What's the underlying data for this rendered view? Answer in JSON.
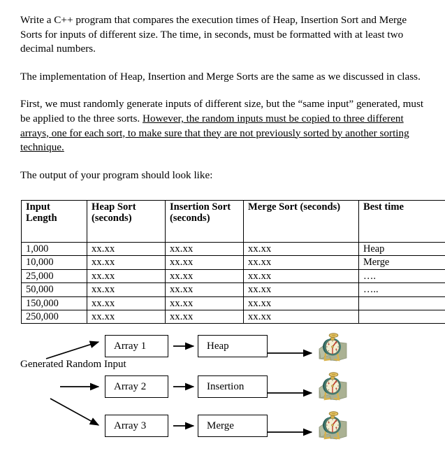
{
  "document": {
    "paragraphs": [
      {
        "id": "p1",
        "text": "Write a C++ program that compares the execution times of Heap, Insertion Sort and Merge Sorts for inputs of different size. The time, in seconds, must be formatted with at least two decimal numbers."
      },
      {
        "id": "p2",
        "text": "The implementation of Heap, Insertion and Merge Sorts are the same as we discussed in class."
      },
      {
        "id": "p3_plain",
        "text": "First, we must randomly generate inputs of different size, but the “same input” generated, must be applied to the three sorts. "
      },
      {
        "id": "p3_underlined",
        "text": "However, the random inputs must be copied to three different arrays, one for each sort, to make sure that they are not previously sorted by another sorting technique."
      },
      {
        "id": "p4",
        "text": "The output of your program should look like:"
      }
    ]
  },
  "table": {
    "headers": [
      "Input Length",
      "Heap Sort (seconds)",
      "Insertion Sort (seconds)",
      "Merge Sort (seconds)",
      "Best time"
    ],
    "rows": [
      {
        "length": "1,000",
        "heap": "xx.xx",
        "insertion": "xx.xx",
        "merge": "xx.xx",
        "best": "Heap"
      },
      {
        "length": "10,000",
        "heap": "xx.xx",
        "insertion": "xx.xx",
        "merge": "xx.xx",
        "best": "Merge"
      },
      {
        "length": "25,000",
        "heap": "xx.xx",
        "insertion": "xx.xx",
        "merge": "xx.xx",
        "best": "…."
      },
      {
        "length": "50,000",
        "heap": "xx.xx",
        "insertion": "xx.xx",
        "merge": "xx.xx",
        "best": "….."
      },
      {
        "length": "150,000",
        "heap": "xx.xx",
        "insertion": "xx.xx",
        "merge": "xx.xx",
        "best": ""
      },
      {
        "length": "250,000",
        "heap": "xx.xx",
        "insertion": "xx.xx",
        "merge": "xx.xx",
        "best": ""
      }
    ]
  },
  "diagram": {
    "source_label": "Generated Random Input",
    "rows": [
      {
        "array": "Array 1",
        "sort": "Heap",
        "timer_icon": "stopwatch-icon"
      },
      {
        "array": "Array 2",
        "sort": "Insertion",
        "timer_icon": "stopwatch-icon"
      },
      {
        "array": "Array 3",
        "sort": "Merge",
        "timer_icon": "stopwatch-icon"
      }
    ],
    "colors": {
      "stopwatch_ring": "#3f7b72",
      "stopwatch_ring_dark": "#2c5c55",
      "stopwatch_dial": "#f2eed2",
      "stopwatch_hands": "#c0392b",
      "stopwatch_gold": "#d7b24c",
      "stopwatch_pad": "#aab193",
      "box_border": "#000000",
      "arrow": "#000000"
    }
  }
}
